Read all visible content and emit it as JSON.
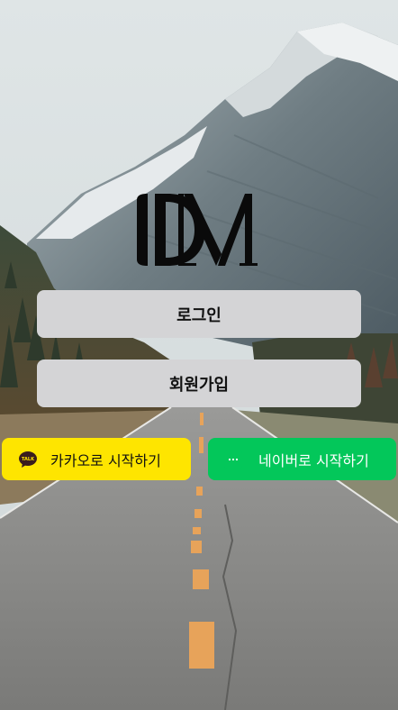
{
  "logo": {
    "text": "DM"
  },
  "buttons": {
    "login_label": "로그인",
    "signup_label": "회원가입",
    "kakao_label": "카카오로 시작하기",
    "naver_label": "네이버로 시작하기"
  },
  "icons": {
    "kakao": "kakao-talk-icon",
    "naver": "naver-icon"
  },
  "colors": {
    "kakao": "#fee500",
    "naver": "#03c75a",
    "primary_button": "#d4d4d6"
  }
}
